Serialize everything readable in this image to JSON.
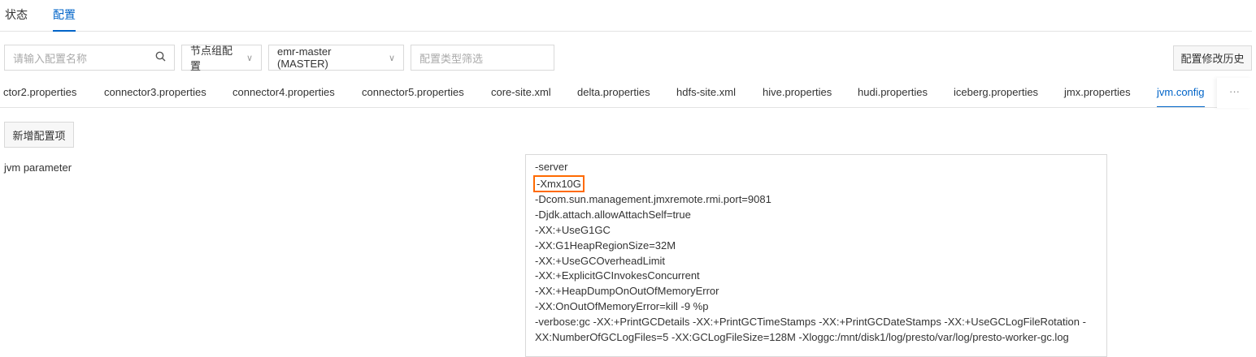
{
  "top_tabs": [
    "状态",
    "配置"
  ],
  "filters": {
    "search_placeholder": "请输入配置名称",
    "scope": "节点组配置",
    "node_group": "emr-master (MASTER)",
    "type_placeholder": "配置类型筛选"
  },
  "history_button": "配置修改历史",
  "file_tabs": [
    "ctor2.properties",
    "connector3.properties",
    "connector4.properties",
    "connector5.properties",
    "core-site.xml",
    "delta.properties",
    "hdfs-site.xml",
    "hive.properties",
    "hudi.properties",
    "iceberg.properties",
    "jmx.properties",
    "jvm.config"
  ],
  "more": "···",
  "add_button": "新增配置项",
  "param_label": "jvm parameter",
  "lines": [
    "-server",
    "-Xmx10G",
    "-Dcom.sun.management.jmxremote.rmi.port=9081",
    "-Djdk.attach.allowAttachSelf=true",
    "-XX:+UseG1GC",
    "-XX:G1HeapRegionSize=32M",
    "-XX:+UseGCOverheadLimit",
    "-XX:+ExplicitGCInvokesConcurrent",
    "-XX:+HeapDumpOnOutOfMemoryError",
    "-XX:OnOutOfMemoryError=kill -9 %p",
    "-verbose:gc -XX:+PrintGCDetails -XX:+PrintGCTimeStamps -XX:+PrintGCDateStamps -XX:+UseGCLogFileRotation -",
    "XX:NumberOfGCLogFiles=5 -XX:GCLogFileSize=128M -Xloggc:/mnt/disk1/log/presto/var/log/presto-worker-gc.log"
  ]
}
